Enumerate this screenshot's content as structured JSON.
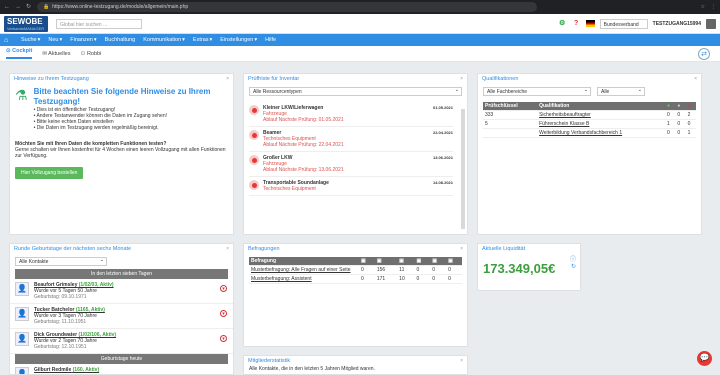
{
  "browser": {
    "url": "https://www.online-testzugang.de/module/allgemein/main.php"
  },
  "header": {
    "logo_text": "SEWOBE",
    "logo_sub": "VerbandsMANAGER",
    "search_placeholder": "Global hier suchen ...",
    "org_select": "Bundesverband",
    "user": "TESTZUGANG15994"
  },
  "menu": {
    "items": [
      "Suche",
      "Neu",
      "Finanzen",
      "Buchhaltung",
      "Kommunikation",
      "Extras",
      "Einstellungen",
      "Hilfe"
    ]
  },
  "tabs": {
    "items": [
      "Cockpit",
      "Aktuelles",
      "Robbi"
    ]
  },
  "hints": {
    "title": "Hinweise zu Ihrem Testzugang",
    "headline": "Bitte beachten Sie folgende Hinweise zu Ihrem Testzugang!",
    "bullets": [
      "Dies ist ein öffentlicher Testzugang!",
      "Andere Testanwender können die Daten im Zugang sehen!",
      "Bitte keine echten Daten einstellen",
      "Die Daten im Testzugang werden regelmäßig bereinigt."
    ],
    "question": "Möchten Sie mit Ihren Daten die kompletten Funktionen testen?",
    "text": "Gerne schalten wir Ihnen kostenfrei für 4 Wochen einen leeren Vollzugang mit allen Funktionen zur Verfügung.",
    "button": "Hier Vollzugang bestellen"
  },
  "inventory": {
    "title": "Prüffriste für Inventar",
    "filter": "Alle Ressourcentypen",
    "items": [
      {
        "name": "Kleiner LKW/Lieferwagen",
        "date": "01.05.2021",
        "type": "Fahrzeuge",
        "due": "Ablauf Nächste Prüfung: 01.05.2021"
      },
      {
        "name": "Beamer",
        "date": "22.04.2021",
        "type": "Technisches Equipment",
        "due": "Ablauf Nächste Prüfung: 22.04.2021"
      },
      {
        "name": "Großer LKW",
        "date": "13.06.2021",
        "type": "Fahrzeuge",
        "due": "Ablauf Nächste Prüfung: 13.06.2021"
      },
      {
        "name": "Transportable Soundanlage",
        "date": "14.08.2021",
        "type": "Technisches Equipment",
        "due": ""
      }
    ]
  },
  "qualifications": {
    "title": "Qualifikationen",
    "filter1": "Alle Fachbereiche",
    "filter2": "Alle",
    "headers": [
      "Prüfschlüssel",
      "Qualifikation",
      "",
      "",
      ""
    ],
    "rows": [
      [
        "333",
        "Sicherheitsbeauftragter",
        "0",
        "0",
        "2"
      ],
      [
        "5",
        "Führerschein Klasse B",
        "1",
        "0",
        "0"
      ],
      [
        "",
        "Weiterbildung Verbandsfachbereich 1",
        "0",
        "0",
        "1"
      ]
    ]
  },
  "birthdays": {
    "title": "Runde Geburtstage der nächsten sechs Monate",
    "filter": "Alle Kontakte",
    "section1": "In den letzten sieben Tagen",
    "section2": "Geburtstage heute",
    "people": [
      {
        "name": "Beaufort Grimsley",
        "id": "(1/02/03, Aktiv)",
        "line": "Wurde vor 5 Tagen 50 Jahre",
        "bday": "Geburtstag: 09.10.1971"
      },
      {
        "name": "Tucker Batchelor",
        "id": "(1165, Aktiv)",
        "line": "Wurde vor 3 Tagen 70 Jahre",
        "bday": "Geburtstag: 11.10.1951"
      },
      {
        "name": "Dick Groundwater",
        "id": "(1/02/106, Aktiv)",
        "line": "Wurde vor 2 Tagen 70 Jahre",
        "bday": "Geburtstag: 12.10.1951"
      },
      {
        "name": "Gilburt Redmile",
        "id": "(160, Aktiv)",
        "line": "",
        "bday": ""
      }
    ]
  },
  "surveys": {
    "title": "Befragungen",
    "header": "Befragung",
    "rows": [
      {
        "name": "Musterbefragung: Alle Fragen auf einer Seite",
        "vals": [
          "0",
          "156",
          "11",
          "0",
          "0",
          "0"
        ]
      },
      {
        "name": "Musterbefragung: Assistent",
        "vals": [
          "0",
          "171",
          "10",
          "0",
          "0",
          "0"
        ]
      }
    ]
  },
  "liquidity": {
    "title": "Aktuelle Liquidität",
    "value": "173.349,05€"
  },
  "members": {
    "title": "Mitgliederstatistik",
    "text": "Alle Kontakte, die in den letzten 5 Jahren Mitglied waren."
  }
}
